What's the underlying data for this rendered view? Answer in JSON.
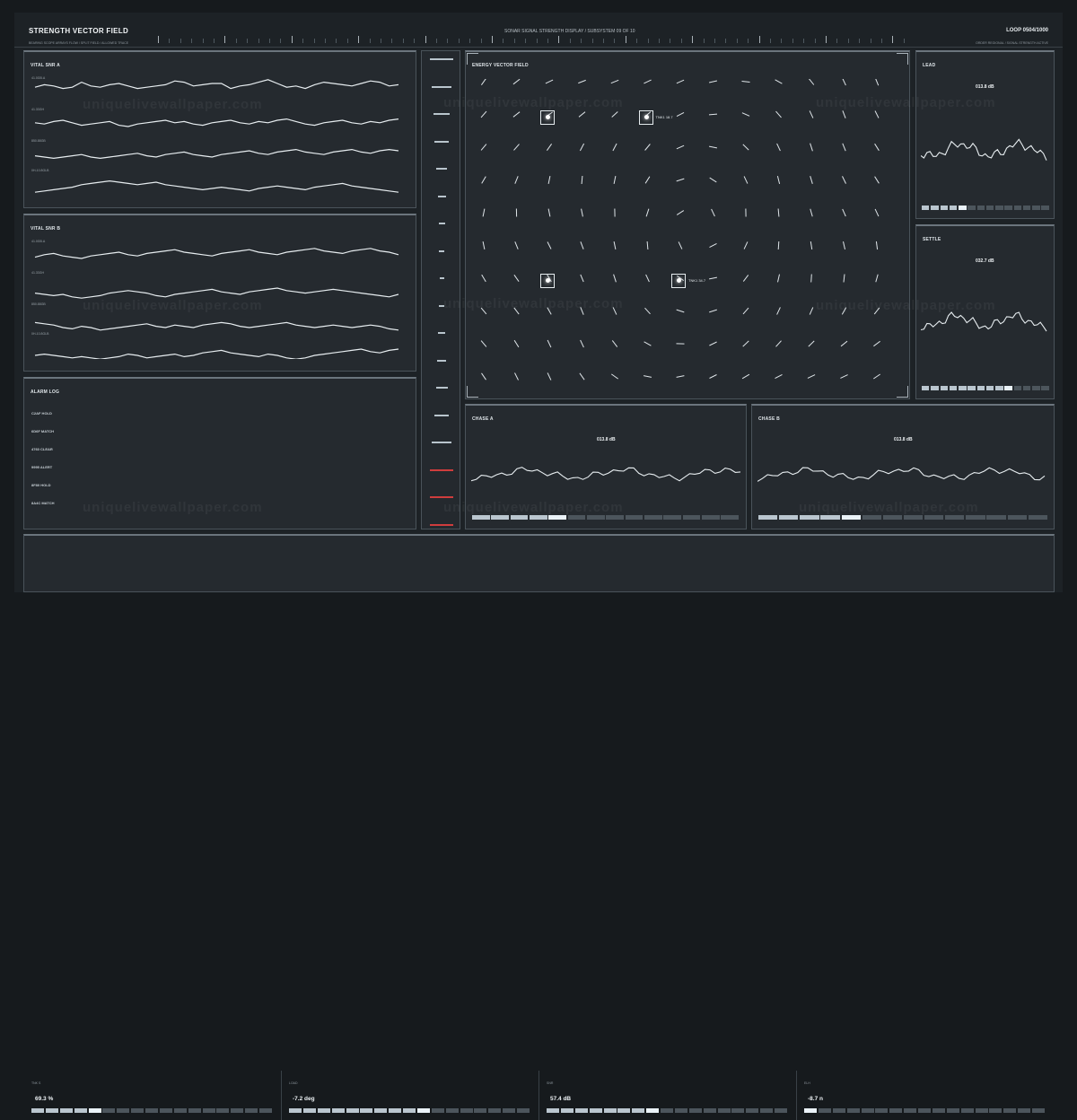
{
  "header": {
    "title": "STRENGTH VECTOR FIELD",
    "left_subtitle": "BEARING SCOPE ARRAYS FLOW / SPLIT FIELD / ALLOWED TRACE",
    "center_title": "SONAR SIGNAL STRENGTH DISPLAY / SUBSYSTEM 09 OF 10",
    "loop": "LOOP 0504/1000",
    "right_subtitle": "ORDER REGIONAL / SIGNAL STRENGTH ACTIVE"
  },
  "watermark": "uniquelivewallpaper.com",
  "left_panels": {
    "vital_a": {
      "title": "VITAL SNR A",
      "labels": [
        "41.0GB.A",
        "41.33GH",
        "850.88GB",
        "0H-10.8GLB"
      ],
      "series": [
        [
          48,
          46,
          47,
          49,
          48,
          44,
          47,
          48,
          46,
          45,
          47,
          49,
          48,
          47,
          46,
          43,
          44,
          47,
          46,
          45,
          45,
          49,
          47,
          46,
          44,
          42,
          45,
          48,
          47,
          49,
          46,
          44,
          45,
          46,
          47,
          45,
          43,
          44,
          47,
          46
        ],
        [
          52,
          53,
          51,
          50,
          52,
          54,
          53,
          52,
          51,
          54,
          55,
          53,
          52,
          51,
          50,
          52,
          51,
          53,
          54,
          52,
          51,
          50,
          52,
          53,
          51,
          52,
          50,
          49,
          51,
          53,
          54,
          52,
          51,
          50,
          52,
          53,
          51,
          52,
          50,
          49
        ],
        [
          54,
          55,
          56,
          55,
          54,
          53,
          55,
          56,
          55,
          54,
          53,
          52,
          54,
          55,
          53,
          52,
          51,
          53,
          54,
          55,
          53,
          52,
          51,
          50,
          52,
          53,
          51,
          50,
          49,
          51,
          52,
          53,
          51,
          50,
          49,
          51,
          52,
          50,
          49,
          50
        ],
        [
          58,
          57,
          56,
          55,
          54,
          52,
          51,
          50,
          49,
          50,
          51,
          52,
          51,
          50,
          52,
          53,
          54,
          55,
          56,
          55,
          54,
          55,
          56,
          57,
          55,
          54,
          53,
          54,
          55,
          56,
          54,
          53,
          52,
          51,
          53,
          54,
          55,
          56,
          57,
          58
        ]
      ]
    },
    "vital_b": {
      "title": "VITAL SNR B",
      "labels": [
        "41.0GB.A",
        "41.33GH",
        "850.88GB",
        "0H-10.8GLB"
      ],
      "series": [
        [
          49,
          47,
          46,
          48,
          49,
          50,
          48,
          47,
          46,
          45,
          47,
          48,
          46,
          45,
          44,
          43,
          45,
          46,
          47,
          48,
          46,
          45,
          44,
          43,
          45,
          46,
          47,
          45,
          44,
          43,
          42,
          44,
          45,
          46,
          44,
          43,
          42,
          44,
          45,
          47
        ],
        [
          54,
          55,
          56,
          55,
          57,
          58,
          57,
          56,
          54,
          53,
          52,
          53,
          54,
          56,
          57,
          55,
          54,
          53,
          52,
          51,
          53,
          54,
          55,
          53,
          52,
          51,
          50,
          52,
          53,
          54,
          53,
          52,
          51,
          52,
          53,
          54,
          55,
          56,
          57,
          55
        ],
        [
          51,
          52,
          53,
          55,
          56,
          54,
          55,
          57,
          56,
          55,
          54,
          53,
          52,
          54,
          55,
          53,
          54,
          55,
          53,
          52,
          51,
          52,
          54,
          55,
          54,
          53,
          52,
          51,
          53,
          54,
          55,
          54,
          53,
          54,
          55,
          54,
          53,
          54,
          56,
          57
        ],
        [
          55,
          54,
          55,
          56,
          57,
          56,
          57,
          58,
          57,
          56,
          54,
          55,
          57,
          56,
          55,
          54,
          56,
          55,
          53,
          52,
          51,
          53,
          54,
          55,
          56,
          54,
          55,
          57,
          58,
          57,
          55,
          54,
          53,
          52,
          51,
          50,
          52,
          53,
          51,
          50
        ]
      ]
    },
    "alarm_log": {
      "title": "ALARM LOG",
      "items": [
        "C2AF HOLD",
        "6D6F MATCH",
        "4760 CLEAR",
        "9995 ALERT",
        "8F80 HOLD",
        "8A4C MATCH"
      ]
    }
  },
  "vector_field": {
    "title": "ENERGY VECTOR FIELD",
    "markers": [
      {
        "label": "",
        "col": 2,
        "row": 1
      },
      {
        "label": "TNK1 18.7",
        "col": 5,
        "row": 1
      },
      {
        "label": "",
        "col": 2,
        "row": 6
      },
      {
        "label": "TNK1 34.7",
        "col": 6,
        "row": 6
      }
    ]
  },
  "right_panels": {
    "lead": {
      "title": "LEAD",
      "value": "013.8 dB",
      "bar_on": 5
    },
    "settle": {
      "title": "SETTLE",
      "value": "032.7 dB",
      "bar_on": 10
    }
  },
  "chase": {
    "a": {
      "title": "CHASE A",
      "value": "013.8 dB",
      "bar_on": 5
    },
    "b": {
      "title": "CHASE B",
      "value": "013.8 dB",
      "bar_on": 5
    }
  },
  "bottom": [
    {
      "label": "TNK S",
      "value": "69.3 %",
      "bar_on": 5
    },
    {
      "label": "LOAD",
      "value": "-7.2 deg",
      "bar_on": 10
    },
    {
      "label": "SNR",
      "value": "57.4 dB",
      "bar_on": 8
    },
    {
      "label": "ELH",
      "value": "-8.7 n",
      "bar_on": 1
    }
  ],
  "colors": {
    "background": "#161a1d",
    "panel": "#252a2f",
    "line": "#e7edf0",
    "alert_red": "#cf3d3d"
  },
  "icons": {
    "marker": "target-square-icon"
  }
}
